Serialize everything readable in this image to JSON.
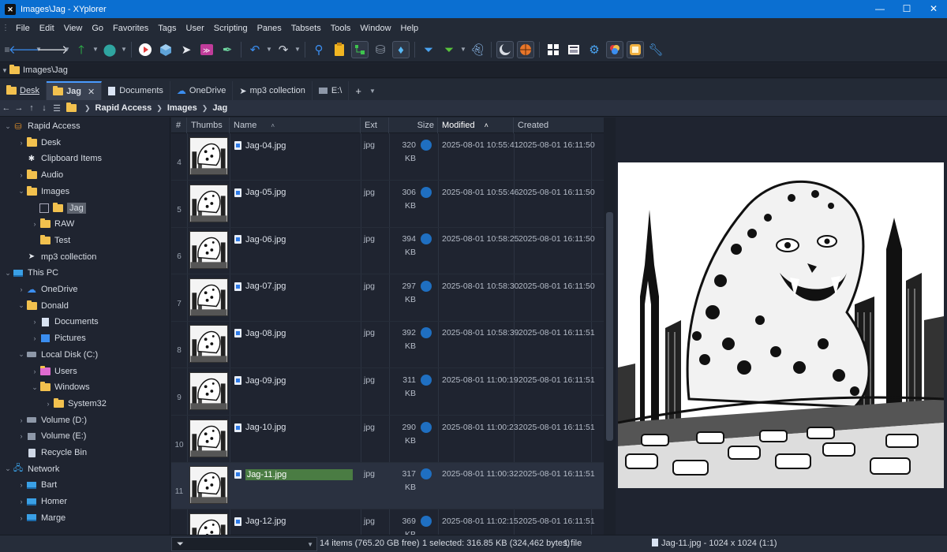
{
  "window": {
    "title": "Images\\Jag - XYplorer",
    "controls": [
      "—",
      "☐",
      "✕"
    ]
  },
  "menu": [
    "File",
    "Edit",
    "View",
    "Go",
    "Favorites",
    "Tags",
    "User",
    "Scripting",
    "Panes",
    "Tabsets",
    "Tools",
    "Window",
    "Help"
  ],
  "address": {
    "path": "Images\\Jag"
  },
  "tabs": [
    {
      "label": "Desk",
      "icon": "folder-icon",
      "active": false
    },
    {
      "label": "Jag",
      "icon": "folder-icon",
      "active": true,
      "close": "✕"
    },
    {
      "label": "Documents",
      "icon": "document-icon",
      "active": false
    },
    {
      "label": "OneDrive",
      "icon": "cloud-icon",
      "active": false
    },
    {
      "label": "mp3 collection",
      "icon": "send-icon",
      "active": false
    },
    {
      "label": "E:\\",
      "icon": "drive-icon",
      "active": false
    }
  ],
  "tab_add": "+",
  "breadcrumb": [
    "Rapid Access",
    "Images",
    "Jag"
  ],
  "tree": [
    {
      "label": "Rapid Access",
      "icon": "rapid-access-icon",
      "level": 0,
      "expanded": true
    },
    {
      "label": "Desk",
      "icon": "folder-icon",
      "level": 1,
      "expanded": false
    },
    {
      "label": "Clipboard Items",
      "icon": "clipboard-icon",
      "level": 1,
      "expanded": null
    },
    {
      "label": "Audio",
      "icon": "folder-icon",
      "level": 1,
      "expanded": false
    },
    {
      "label": "Images",
      "icon": "folder-icon",
      "level": 1,
      "expanded": true
    },
    {
      "label": "Jag",
      "icon": "folder-icon",
      "level": 2,
      "expanded": null,
      "selected": true
    },
    {
      "label": "RAW",
      "icon": "folder-icon",
      "level": 2,
      "expanded": false
    },
    {
      "label": "Test",
      "icon": "folder-icon",
      "level": 2,
      "expanded": null
    },
    {
      "label": "mp3 collection",
      "icon": "send-icon",
      "level": 1,
      "expanded": null
    },
    {
      "label": "This PC",
      "icon": "monitor-icon",
      "level": 0,
      "expanded": true
    },
    {
      "label": "OneDrive",
      "icon": "cloud-icon",
      "level": 1,
      "expanded": false
    },
    {
      "label": "Donald",
      "icon": "folder-icon",
      "level": 1,
      "expanded": true
    },
    {
      "label": "Documents",
      "icon": "document-icon",
      "level": 2,
      "expanded": false
    },
    {
      "label": "Pictures",
      "icon": "pictures-icon",
      "level": 2,
      "expanded": false
    },
    {
      "label": "Local Disk (C:)",
      "icon": "drive-icon",
      "level": 1,
      "expanded": true
    },
    {
      "label": "Users",
      "icon": "folder-pink-icon",
      "level": 2,
      "expanded": false
    },
    {
      "label": "Windows",
      "icon": "folder-icon",
      "level": 2,
      "expanded": true
    },
    {
      "label": "System32",
      "icon": "folder-icon",
      "level": 3,
      "expanded": false
    },
    {
      "label": "Volume (D:)",
      "icon": "drive-icon",
      "level": 1,
      "expanded": false
    },
    {
      "label": "Volume (E:)",
      "icon": "usb-drive-icon",
      "level": 1,
      "expanded": false
    },
    {
      "label": "Recycle Bin",
      "icon": "recycle-bin-icon",
      "level": 1,
      "expanded": null
    },
    {
      "label": "Network",
      "icon": "network-icon",
      "level": 0,
      "expanded": true
    },
    {
      "label": "Bart",
      "icon": "monitor-icon",
      "level": 1,
      "expanded": false
    },
    {
      "label": "Homer",
      "icon": "monitor-icon",
      "level": 1,
      "expanded": false
    },
    {
      "label": "Marge",
      "icon": "monitor-icon",
      "level": 1,
      "expanded": false
    }
  ],
  "columns": {
    "num": "#",
    "thumbs": "Thumbs",
    "name": "Name",
    "ext": "Ext",
    "size": "Size",
    "modified": "Modified",
    "created": "Created"
  },
  "files": [
    {
      "num": "4",
      "name": "Jag-04.jpg",
      "ext": "jpg",
      "size": "320 KB",
      "modified": "2025-08-01 10:55:41",
      "created": "2025-08-01 16:11:50"
    },
    {
      "num": "5",
      "name": "Jag-05.jpg",
      "ext": "jpg",
      "size": "306 KB",
      "modified": "2025-08-01 10:55:46",
      "created": "2025-08-01 16:11:50"
    },
    {
      "num": "6",
      "name": "Jag-06.jpg",
      "ext": "jpg",
      "size": "394 KB",
      "modified": "2025-08-01 10:58:25",
      "created": "2025-08-01 16:11:50"
    },
    {
      "num": "7",
      "name": "Jag-07.jpg",
      "ext": "jpg",
      "size": "297 KB",
      "modified": "2025-08-01 10:58:30",
      "created": "2025-08-01 16:11:50"
    },
    {
      "num": "8",
      "name": "Jag-08.jpg",
      "ext": "jpg",
      "size": "392 KB",
      "modified": "2025-08-01 10:58:39",
      "created": "2025-08-01 16:11:51"
    },
    {
      "num": "9",
      "name": "Jag-09.jpg",
      "ext": "jpg",
      "size": "311 KB",
      "modified": "2025-08-01 11:00:19",
      "created": "2025-08-01 16:11:51"
    },
    {
      "num": "10",
      "name": "Jag-10.jpg",
      "ext": "jpg",
      "size": "290 KB",
      "modified": "2025-08-01 11:00:23",
      "created": "2025-08-01 16:11:51"
    },
    {
      "num": "11",
      "name": "Jag-11.jpg",
      "ext": "jpg",
      "size": "317 KB",
      "modified": "2025-08-01 11:00:32",
      "created": "2025-08-01 16:11:51",
      "selected": true
    },
    {
      "num": "12",
      "name": "Jag-12.jpg",
      "ext": "jpg",
      "size": "369 KB",
      "modified": "2025-08-01 11:02:15",
      "created": "2025-08-01 16:11:51"
    }
  ],
  "status": {
    "items": "14 items (765.20 GB free)",
    "selected": "1 selected: 316.85 KB (324,462 bytes)",
    "files": "1 file",
    "preview_info": "Jag-11.jpg - 1024 x 1024 (1:1)"
  },
  "colors": {
    "accent": "#0b6fd1",
    "selection": "#4a7c43",
    "background": "#1f2430"
  }
}
